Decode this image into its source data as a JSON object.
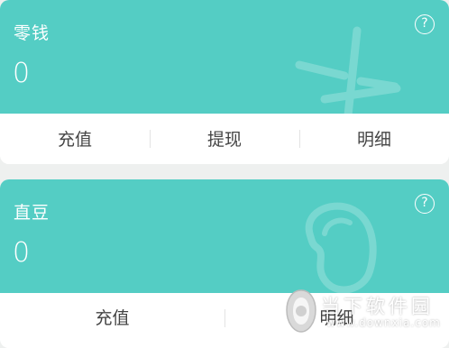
{
  "cards": [
    {
      "title": "零钱",
      "amount": "0",
      "help_label": "?",
      "actions": [
        "充值",
        "提现",
        "明细"
      ]
    },
    {
      "title": "直豆",
      "amount": "0",
      "help_label": "?",
      "actions": [
        "充值",
        "明细"
      ]
    }
  ],
  "colors": {
    "accent": "#54cdc4",
    "background": "#eef0ef",
    "action_text": "#444444"
  },
  "overlay": {
    "name": "当下软件园",
    "url": "www.downxia.com"
  }
}
